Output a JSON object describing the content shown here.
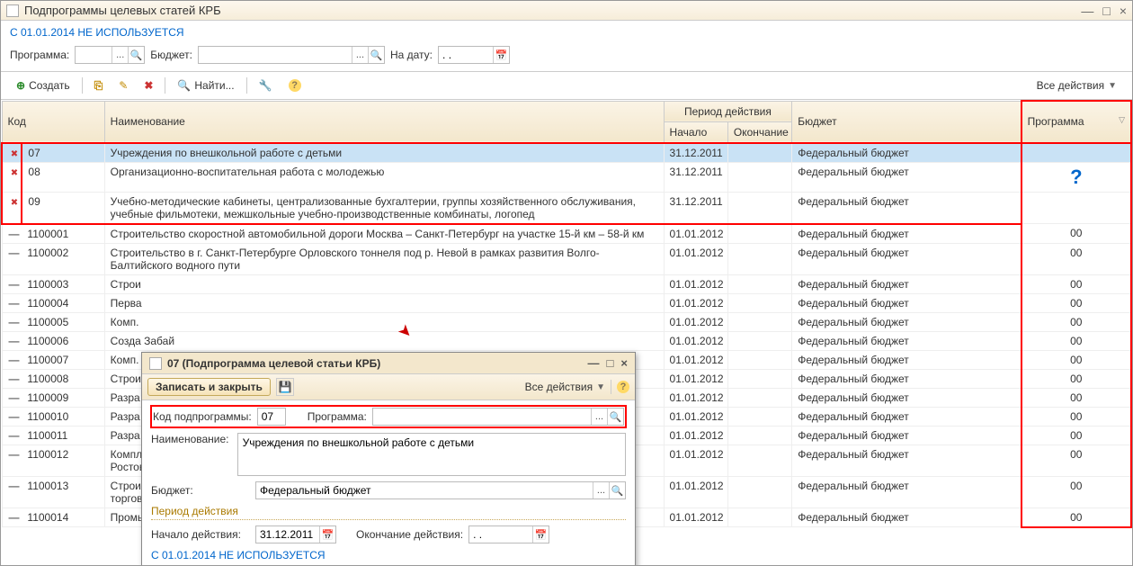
{
  "window": {
    "title": "Подпрограммы целевых статей КРБ",
    "notice": "С 01.01.2014 НЕ ИСПОЛЬЗУЕТСЯ"
  },
  "filter": {
    "program_label": "Программа:",
    "budget_label": "Бюджет:",
    "date_label": "На дату:",
    "date_value": ". .",
    "clear": "×",
    "search": "🔍",
    "ellipsis": "...",
    "calendar": "📅"
  },
  "toolbar": {
    "create": "Создать",
    "find": "Найти...",
    "all_actions": "Все действия"
  },
  "headers": {
    "code": "Код",
    "name": "Наименование",
    "period": "Период действия",
    "start": "Начало",
    "end": "Окончание",
    "budget": "Бюджет",
    "program": "Программа"
  },
  "budget_fed": "Федеральный бюджет",
  "qmark": "?",
  "rows": [
    {
      "icon": "bad",
      "code": "07",
      "name": "Учреждения по внешкольной работе с детьми",
      "start": "31.12.2011",
      "end": "",
      "budget": "Федеральный бюджет",
      "prog": "",
      "sel": true,
      "red": true
    },
    {
      "icon": "bad",
      "code": "08",
      "name": "Организационно-воспитательная работа с молодежью",
      "start": "31.12.2011",
      "end": "",
      "budget": "Федеральный бюджет",
      "prog": "",
      "red": true
    },
    {
      "icon": "bad",
      "code": "09",
      "name": "Учебно-методические кабинеты, централизованные бухгалтерии, группы хозяйственного обслуживания, учебные фильмотеки, межшкольные учебно-производственные комбинаты, логопед",
      "start": "31.12.2011",
      "end": "",
      "budget": "Федеральный бюджет",
      "prog": "",
      "red": true
    },
    {
      "icon": "minus",
      "code": "1100001",
      "name": "Строительство скоростной автомобильной дороги Москва – Санкт-Петербург на участке 15-й км – 58-й км",
      "start": "01.01.2012",
      "end": "",
      "budget": "Федеральный бюджет",
      "prog": "00"
    },
    {
      "icon": "minus",
      "code": "1100002",
      "name": "Строительство в г. Санкт-Петербурге Орловского тоннеля под р. Невой в рамках развития Волго-Балтийского водного пути",
      "start": "01.01.2012",
      "end": "",
      "budget": "Федеральный бюджет",
      "prog": "00"
    },
    {
      "icon": "minus",
      "code": "1100003",
      "name": "Строи",
      "start": "01.01.2012",
      "end": "",
      "budget": "Федеральный бюджет",
      "prog": "00"
    },
    {
      "icon": "minus",
      "code": "1100004",
      "name": "Перва",
      "start": "01.01.2012",
      "end": "",
      "budget": "Федеральный бюджет",
      "prog": "00"
    },
    {
      "icon": "minus",
      "code": "1100005",
      "name": "Комп.",
      "start": "01.01.2012",
      "end": "",
      "budget": "Федеральный бюджет",
      "prog": "00"
    },
    {
      "icon": "minus",
      "code": "1100006",
      "name": "Созда Забай",
      "start": "01.01.2012",
      "end": "",
      "budget": "Федеральный бюджет",
      "prog": "00"
    },
    {
      "icon": "minus",
      "code": "1100007",
      "name": "Комп.",
      "start": "01.01.2012",
      "end": "",
      "budget": "Федеральный бюджет",
      "prog": "00"
    },
    {
      "icon": "minus",
      "code": "1100008",
      "name": "Строи Респу",
      "start": "01.01.2012",
      "end": "",
      "budget": "Федеральный бюджет",
      "prog": "00"
    },
    {
      "icon": "minus",
      "code": "1100009",
      "name": "Разра Санкт",
      "start": "01.01.2012",
      "end": "",
      "budget": "Федеральный бюджет",
      "prog": "00"
    },
    {
      "icon": "minus",
      "code": "1100010",
      "name": "Разра кольц",
      "start": "01.01.2012",
      "end": "",
      "budget": "Федеральный бюджет",
      "prog": "00"
    },
    {
      "icon": "minus",
      "code": "1100011",
      "name": "Разра Якути",
      "start": "01.01.2012",
      "end": "",
      "budget": "Федеральный бюджет",
      "prog": "00"
    },
    {
      "icon": "minus",
      "code": "1100012",
      "name": "Комплексная программа строительства и реконструкции объектов водоснабжения и водоотведения г. Ростова-на-Дону и юго-запада Ростовской области",
      "start": "01.01.2012",
      "end": "",
      "budget": "Федеральный бюджет",
      "prog": "00"
    },
    {
      "icon": "minus",
      "code": "1100013",
      "name": "Строительство и последующая эксплуатация многопрофильного перегрузочного комплекса «Юг-2» в торговом порту Усть-Луга",
      "start": "01.01.2012",
      "end": "",
      "budget": "Федеральный бюджет",
      "prog": "00"
    },
    {
      "icon": "minus",
      "code": "1100014",
      "name": "Промышленный комплекс г. Новомосковск Тульской области",
      "start": "01.01.2012",
      "end": "",
      "budget": "Федеральный бюджет",
      "prog": "00"
    }
  ],
  "dialog": {
    "title": "07 (Подпрограмма целевой статьи КРБ)",
    "save_close": "Записать и закрыть",
    "all_actions": "Все действия",
    "code_label": "Код подпрограммы:",
    "code_value": "07",
    "program_label": "Программа:",
    "program_value": "",
    "name_label": "Наименование:",
    "name_value": "Учреждения по внешкольной работе с детьми",
    "budget_label": "Бюджет:",
    "budget_value": "Федеральный бюджет",
    "period_heading": "Период действия",
    "start_label": "Начало действия:",
    "start_value": "31.12.2011",
    "end_label": "Окончание действия:",
    "end_value": ". .",
    "notice": "С 01.01.2014 НЕ ИСПОЛЬЗУЕТСЯ"
  }
}
